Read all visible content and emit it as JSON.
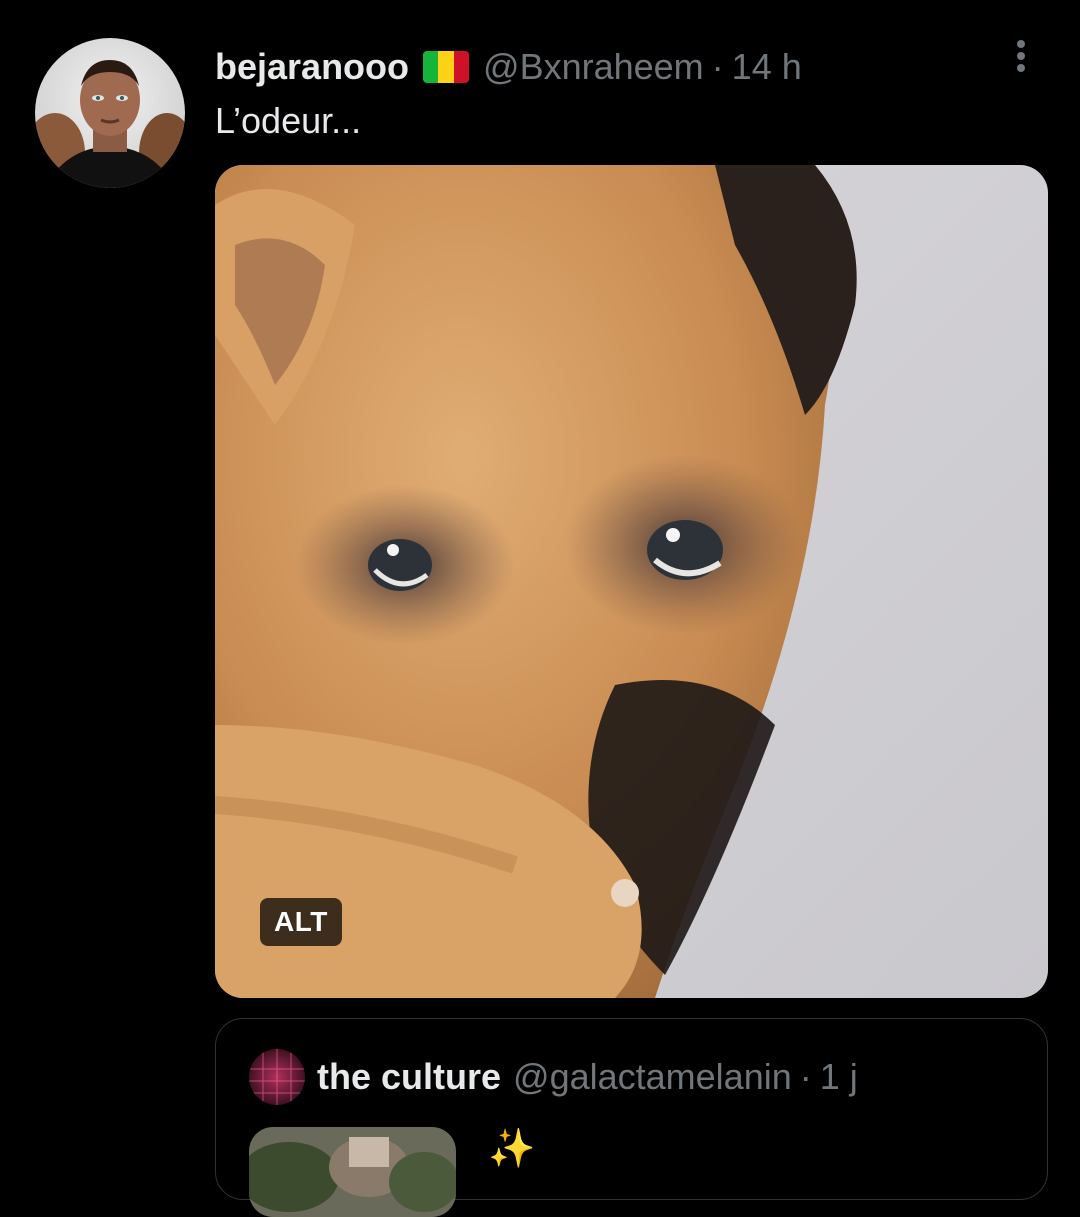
{
  "tweet": {
    "display_name": "bejaranooo",
    "flag_icon": "mali-flag-icon",
    "flag_colors": [
      "#14b53a",
      "#fcd116",
      "#ce1126"
    ],
    "handle": "@Bxnraheem",
    "separator": "·",
    "time": "14 h",
    "text": "L’odeur...",
    "media": {
      "alt_label": "ALT"
    },
    "more_icon": "more-options-icon"
  },
  "quoted_tweet": {
    "display_name": "the culture",
    "handle": "@galactamelanin",
    "separator": "·",
    "time": "1 j",
    "sparkle": "✨"
  },
  "colors": {
    "background": "#000000",
    "primary_text": "#e7e9ea",
    "secondary_text": "#71767b",
    "border": "#2f3336"
  }
}
